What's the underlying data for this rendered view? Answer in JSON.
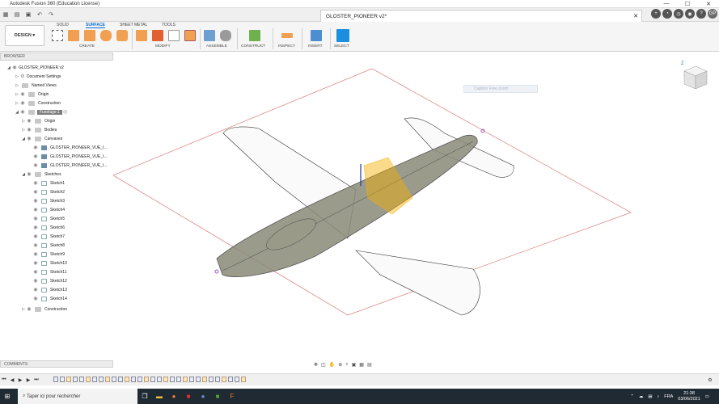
{
  "window": {
    "title": "Autodesk Fusion 360 (Education License)",
    "minimize": "—",
    "maximize": "☐",
    "close": "✕"
  },
  "doc_tab": {
    "title": "GLOSTER_PIONEER v2*",
    "close": "✕"
  },
  "app_icons": {
    "grid": "grid-icon",
    "file": "file-icon",
    "save": "save-icon",
    "undo": "undo-icon",
    "redo": "redo-icon",
    "avatar": "GP"
  },
  "ribbon": {
    "design_label": "DESIGN",
    "tabs": [
      "SOLID",
      "SURFACE",
      "SHEET METAL",
      "TOOLS"
    ],
    "active_tab": "SURFACE",
    "groups": [
      "CREATE",
      "MODIFY",
      "ASSEMBLE",
      "CONSTRUCT",
      "INSPECT",
      "INSERT",
      "SELECT"
    ]
  },
  "browser": {
    "header": "BROWSER",
    "root": "GLOSTER_PIONEER v2",
    "items": {
      "doc_settings": "Document Settings",
      "named_views": "Named Views",
      "origin": "Origin",
      "construction": "Construction",
      "fuselage": "Fuselage:1",
      "fus_origin": "Origin",
      "bodies": "Bodies",
      "canvases": "Canvases",
      "canvas1": "GLOSTER_PIONEER_VUE_I...",
      "canvas2": "GLOSTER_PIONEER_VUE_I...",
      "canvas3": "GLOSTER_PIONEER_VUE_I...",
      "sketches": "Sketches",
      "sketch_list": [
        "Sketch1",
        "Sketch2",
        "Sketch3",
        "Sketch4",
        "Sketch5",
        "Sketch6",
        "Sketch7",
        "Sketch8",
        "Sketch9",
        "Sketch10",
        "Sketch11",
        "Sketch12",
        "Sketch13",
        "Sketch14"
      ],
      "fus_construction": "Construction"
    }
  },
  "canvas": {
    "caption": "Caption Free zoom",
    "top_label": "Z"
  },
  "comments": {
    "label": "COMMENTS"
  },
  "taskbar": {
    "search_placeholder": "Taper ici pour rechercher",
    "lang": "FRA",
    "time": "21:38",
    "date": "03/06/2021"
  },
  "colors": {
    "accent": "#0b6fce",
    "body": "#8a8a78",
    "selection": "#f5b000",
    "taskbar": "#1f2a33"
  }
}
